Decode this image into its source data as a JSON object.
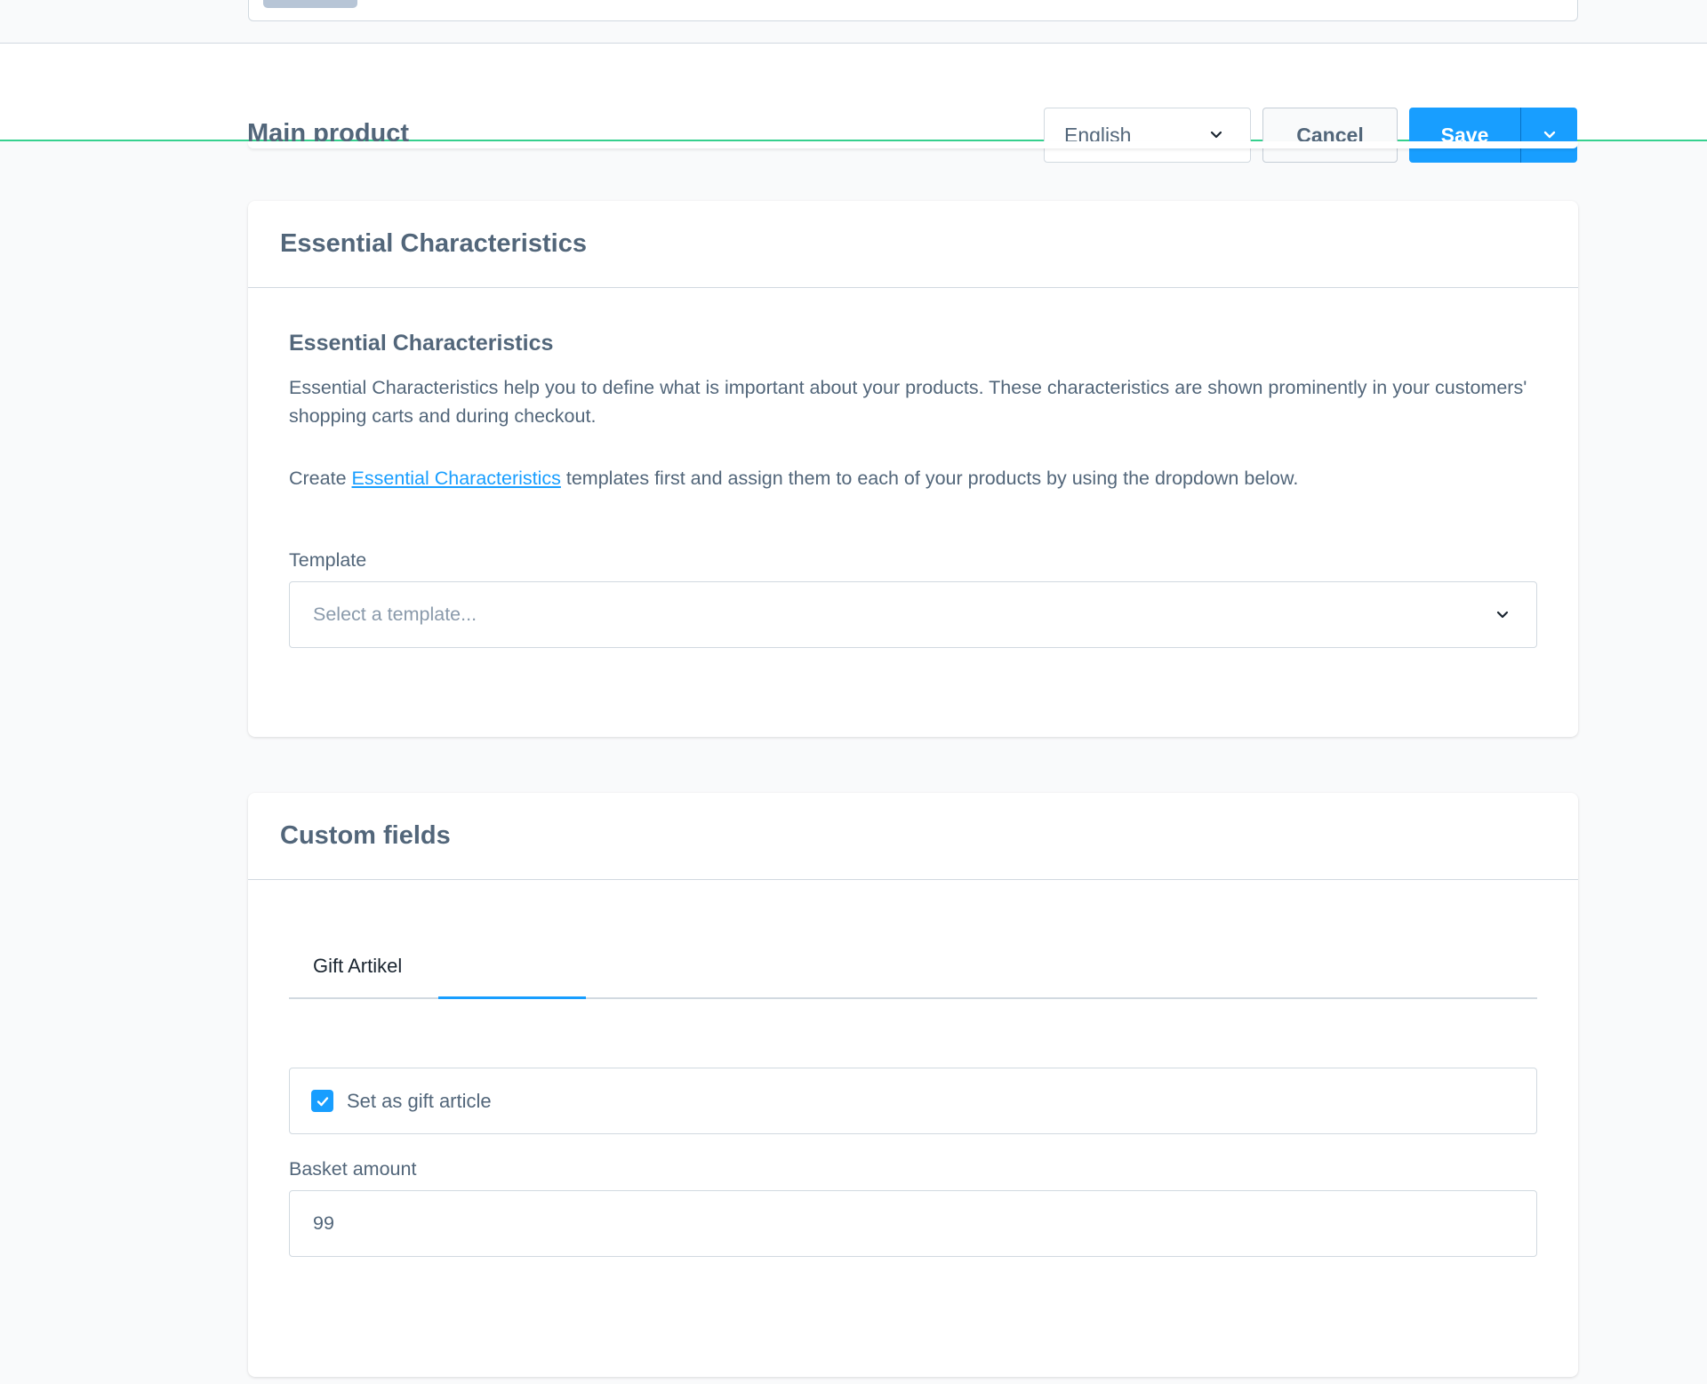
{
  "smartbar": {
    "title": "Main product",
    "language": "English",
    "cancel_label": "Cancel",
    "save_label": "Save"
  },
  "essential_characteristics": {
    "card_title": "Essential Characteristics",
    "subtitle": "Essential Characteristics",
    "description": "Essential Characteristics help you to define what is important about your products. These characteristics are shown prominently in your customers' shopping carts and during checkout.",
    "create_prefix": "Create ",
    "create_link": "Essential Characteristics",
    "create_suffix": " templates first and assign them to each of your products by using the dropdown below.",
    "template_label": "Template",
    "template_placeholder": "Select a template..."
  },
  "custom_fields": {
    "card_title": "Custom fields",
    "tabs": [
      {
        "label": "Gift Artikel"
      }
    ],
    "gift_checkbox_label": "Set as gift article",
    "gift_checked": true,
    "basket_label": "Basket amount",
    "basket_value": "99"
  },
  "colors": {
    "accent": "#189eff",
    "success_bar": "#37d18f"
  }
}
